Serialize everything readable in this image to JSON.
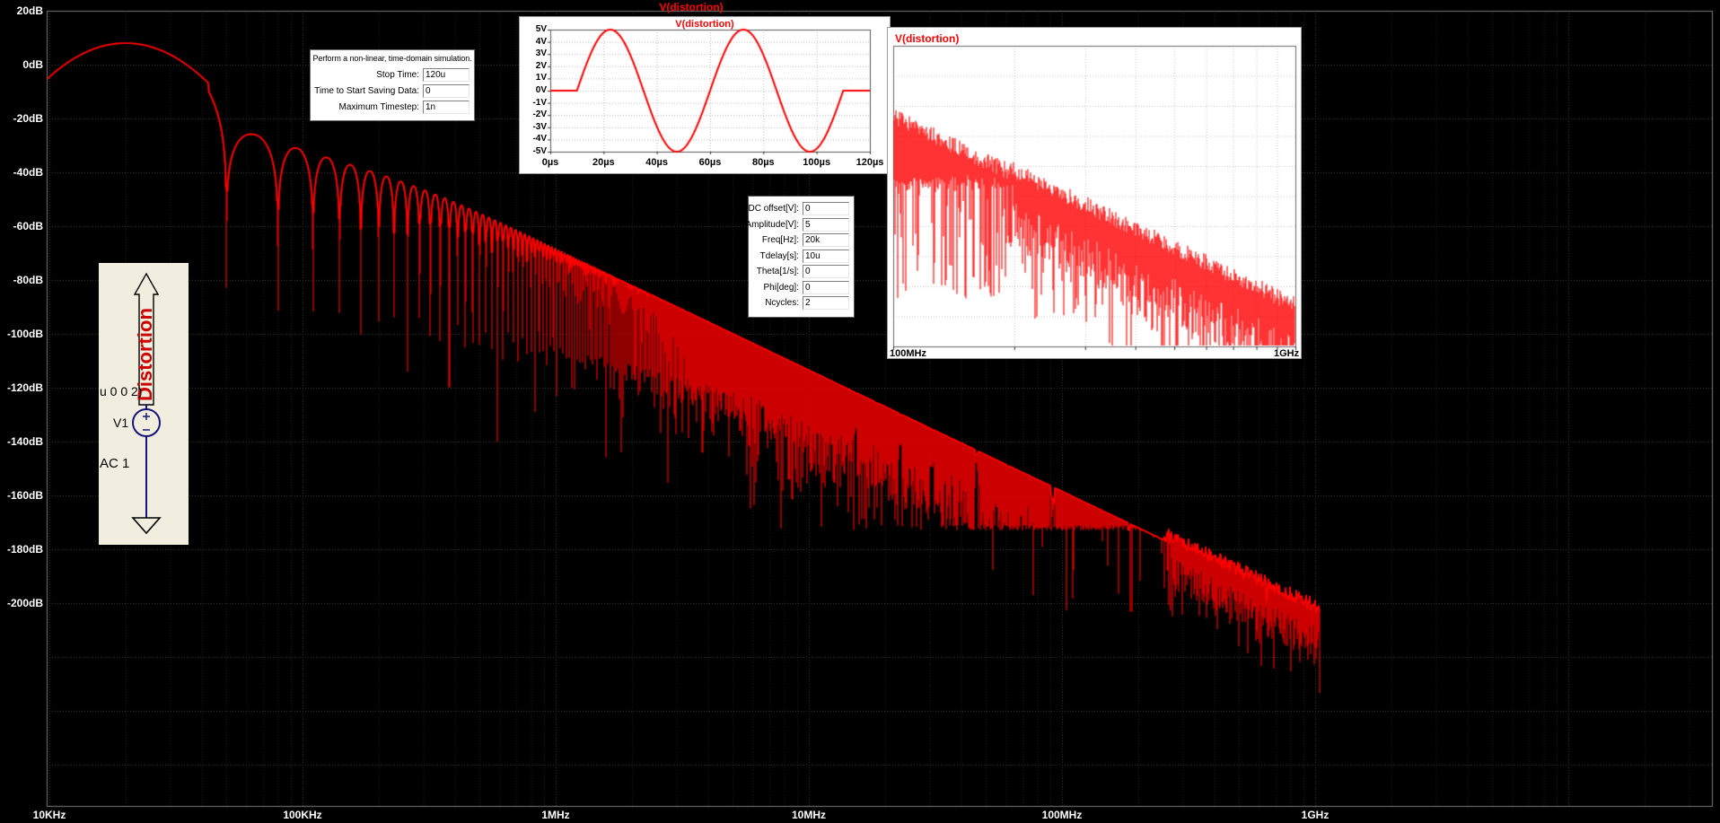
{
  "app": {
    "trace_color": "#FF0000",
    "title_color": "#FF0000",
    "plot_bg": "#000000",
    "grid_color": "#3F3F3F",
    "panel_bg": "#FFFFFF",
    "schematic_bg": "#F2EEDF",
    "wire_color": "#15157D",
    "net_label_color": "#CC0000"
  },
  "main_plot": {
    "title": "V(distortion)",
    "y_labels": [
      "20dB",
      "0dB",
      "-20dB",
      "-40dB",
      "-60dB",
      "-80dB",
      "-100dB",
      "-120dB",
      "-140dB",
      "-160dB",
      "-180dB",
      "-200dB"
    ],
    "x_labels": [
      "10KHz",
      "100KHz",
      "1MHz",
      "10MHz",
      "100MHz",
      "1GHz"
    ]
  },
  "tran_dialog": {
    "intro": "Perform a non-linear, time-domain simulation.",
    "fields": [
      {
        "name": "stop-time",
        "label": "Stop Time:",
        "value": "120u"
      },
      {
        "name": "time-to-start-saving",
        "label": "Time to Start Saving Data:",
        "value": "0"
      },
      {
        "name": "maximum-timestep",
        "label": "Maximum Timestep:",
        "value": "1n"
      }
    ]
  },
  "source_dialog": {
    "fields": [
      {
        "name": "dc-offset",
        "label": "DC offset[V]:",
        "value": "0"
      },
      {
        "name": "amplitude",
        "label": "Amplitude[V]:",
        "value": "5"
      },
      {
        "name": "freq",
        "label": "Freq[Hz]:",
        "value": "20k"
      },
      {
        "name": "tdelay",
        "label": "Tdelay[s]:",
        "value": "10u"
      },
      {
        "name": "theta",
        "label": "Theta[1/s]:",
        "value": "0"
      },
      {
        "name": "phi",
        "label": "Phi[deg]:",
        "value": "0"
      },
      {
        "name": "ncycles",
        "label": "Ncycles:",
        "value": "2"
      }
    ]
  },
  "schematic": {
    "net_label": "Distortion",
    "component": "V1",
    "spice_fragment": "u 0 0 2)",
    "ac_label": "AC 1"
  },
  "chart_data": [
    {
      "type": "line",
      "role": "fft-spectrum",
      "title": "V(distortion)",
      "x_axis": {
        "scale": "log",
        "ticks": [
          "10KHz",
          "100KHz",
          "1MHz",
          "10MHz",
          "100MHz",
          "1GHz"
        ],
        "range_hz": [
          10000,
          40000000000
        ]
      },
      "y_axis": {
        "unit": "dB",
        "ticks_db": [
          20,
          0,
          -20,
          -40,
          -60,
          -80,
          -100,
          -120,
          -140,
          -160,
          -180,
          -200
        ]
      },
      "signal": {
        "fundamental_hz": 20000,
        "peak_db": 8,
        "envelope_slope_db_per_decade": -45,
        "lobe_null_spacing_hz": 30000,
        "noise_floor_db": -172,
        "trace_end_hz": 1050000000
      },
      "envelope_points_db": [
        {
          "hz": 10000,
          "db": -5
        },
        {
          "hz": 20000,
          "db": 8
        },
        {
          "hz": 65000,
          "db": -22
        },
        {
          "hz": 1000000,
          "db": -65
        },
        {
          "hz": 10000000,
          "db": -110
        },
        {
          "hz": 100000000,
          "db": -153
        },
        {
          "hz": 1000000000,
          "db": -199
        }
      ]
    },
    {
      "type": "line",
      "role": "transient",
      "title": "V(distortion)",
      "x_ticks": [
        "0µs",
        "20µs",
        "40µs",
        "60µs",
        "80µs",
        "100µs",
        "120µs"
      ],
      "y_ticks": [
        "5V",
        "4V",
        "3V",
        "2V",
        "1V",
        "0V",
        "-1V",
        "-2V",
        "-3V",
        "-4V",
        "-5V"
      ],
      "waveform": {
        "amplitude_v": 5,
        "freq_hz": 20000,
        "tdelay_us": 10,
        "ncycles": 2,
        "t_end_us": 120
      }
    },
    {
      "type": "line",
      "role": "fft-zoom",
      "title": "V(distortion)",
      "x_ticks": [
        "100MHz",
        "1GHz"
      ],
      "x_range_hz": [
        100000000,
        1000000000
      ],
      "y_range_db": [
        -140,
        -210
      ]
    }
  ]
}
